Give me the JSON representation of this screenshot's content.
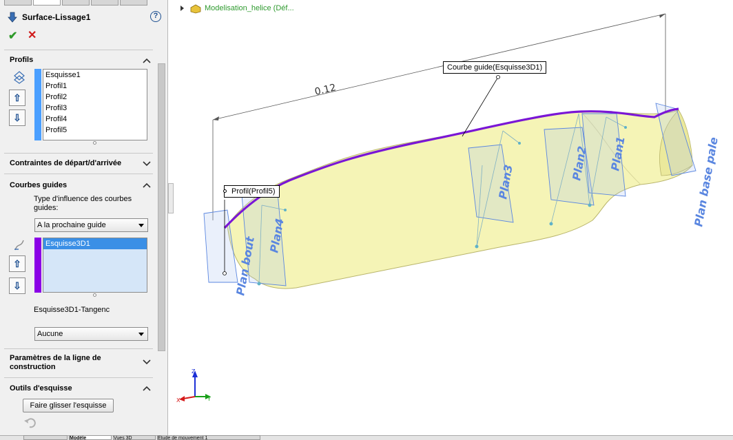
{
  "feature": {
    "title": "Surface-Lissage1",
    "help_label": "?",
    "ok_label": "✔",
    "cancel_label": "✕"
  },
  "profiles": {
    "header": "Profils",
    "items": [
      "Esquisse1",
      "Profil1",
      "Profil2",
      "Profil3",
      "Profil4",
      "Profil5"
    ],
    "color": "#4a9fff"
  },
  "start_end": {
    "header": "Contraintes de départ/d'arrivée"
  },
  "guides": {
    "header": "Courbes guides",
    "influence_label": "Type d'influence des courbes guides:",
    "influence_value": "A la prochaine guide",
    "items": [
      "Esquisse3D1"
    ],
    "color": "#8a00e6",
    "tangency_label": "Esquisse3D1-Tangenc",
    "tangency_value": "Aucune"
  },
  "centerline": {
    "header": "Paramètres de la ligne de construction"
  },
  "sketch_tools": {
    "header": "Outils d'esquisse",
    "drag_button": "Faire glisser l'esquisse"
  },
  "bottom_tabs": [
    "Modèle",
    "Vues 3D",
    "Etude de mouvement 1"
  ],
  "viewport": {
    "tree_label": "Modelisation_helice  (Déf...",
    "dimension": "0.12",
    "guide_callout": "Courbe guide(Esquisse3D1)",
    "profile_callout": "Profil(Profil5)",
    "planes": [
      "Plan bout",
      "Plan4",
      "Plan3",
      "Plan2",
      "Plan1",
      "Plan base pale"
    ],
    "triad": {
      "x": "X",
      "y": "Y",
      "z": "Z"
    },
    "surface_color": "#f5f4b6",
    "guide_color": "#7a16d6",
    "plane_color": "#5a86e0"
  }
}
